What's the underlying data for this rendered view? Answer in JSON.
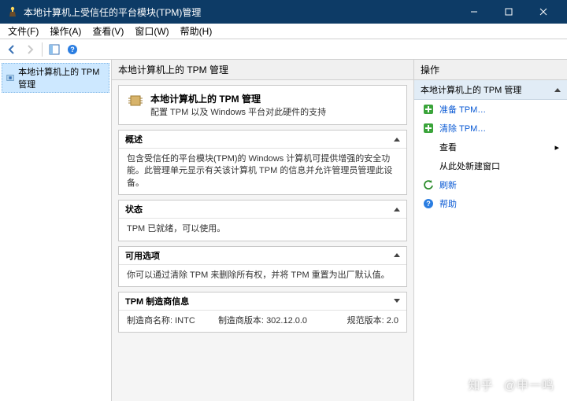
{
  "window": {
    "title": "本地计算机上受信任的平台模块(TPM)管理"
  },
  "menu": {
    "file": "文件(F)",
    "action": "操作(A)",
    "view": "查看(V)",
    "window": "窗口(W)",
    "help": "帮助(H)"
  },
  "tree": {
    "root": "本地计算机上的 TPM 管理"
  },
  "mid": {
    "header": "本地计算机上的 TPM 管理",
    "welcome": {
      "title": "本地计算机上的 TPM 管理",
      "subtitle": "配置 TPM 以及 Windows 平台对此硬件的支持"
    },
    "sections": {
      "overview": {
        "title": "概述",
        "body": "包含受信任的平台模块(TPM)的 Windows 计算机可提供增强的安全功能。此管理单元显示有关该计算机 TPM 的信息并允许管理员管理此设备。"
      },
      "status": {
        "title": "状态",
        "body": "TPM 已就绪，可以使用。"
      },
      "options": {
        "title": "可用选项",
        "body": "你可以通过清除 TPM 来删除所有权，并将 TPM 重置为出厂默认值。"
      },
      "manu": {
        "title": "TPM 制造商信息",
        "name_label": "制造商名称:",
        "name_value": "INTC",
        "ver_label": "制造商版本:",
        "ver_value": "302.12.0.0",
        "spec_label": "规范版本:",
        "spec_value": "2.0"
      }
    }
  },
  "right": {
    "header": "操作",
    "title": "本地计算机上的 TPM 管理",
    "items": {
      "prepare": "准备 TPM…",
      "clear": "清除 TPM…",
      "view": "查看",
      "newwin": "从此处新建窗口",
      "refresh": "刷新",
      "help": "帮助"
    }
  },
  "watermark": {
    "site": "知乎",
    "user": "@申一鸣"
  }
}
